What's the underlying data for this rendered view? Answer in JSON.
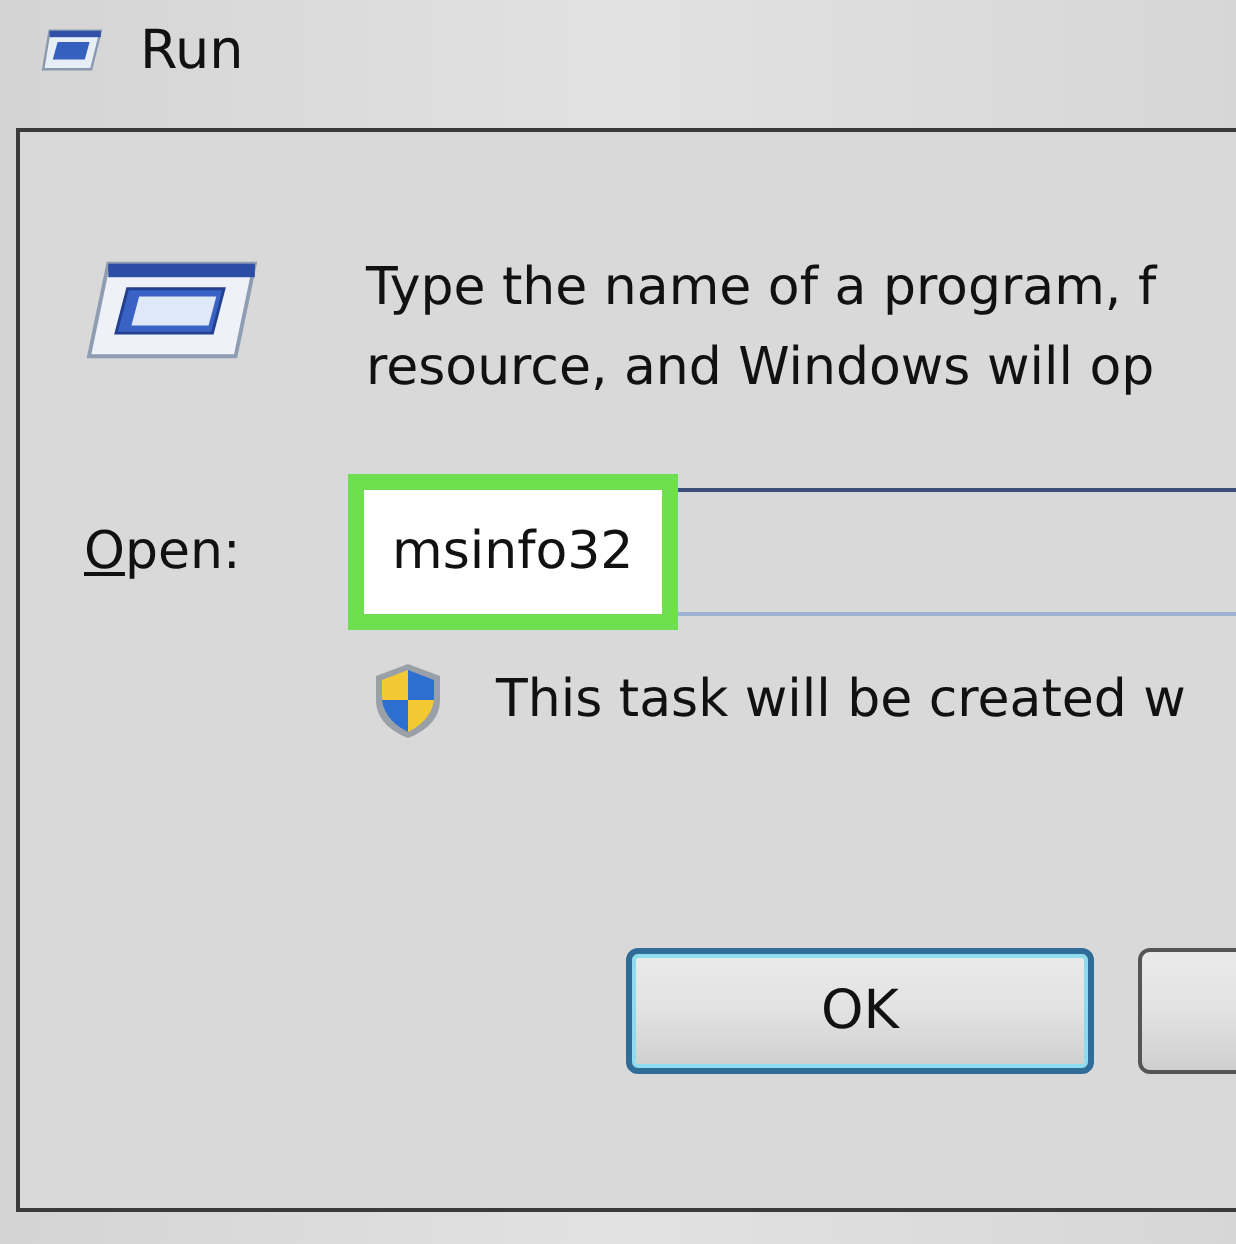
{
  "window": {
    "title": "Run"
  },
  "description": [
    "Type the name of a program, f",
    "resource, and Windows will op"
  ],
  "open": {
    "label": "Open:",
    "mnemonic_underlined": true,
    "value": "msinfo32",
    "highlighted": true
  },
  "admin_note": "This task will be created w",
  "buttons": [
    {
      "label": "OK",
      "default": true
    }
  ]
}
